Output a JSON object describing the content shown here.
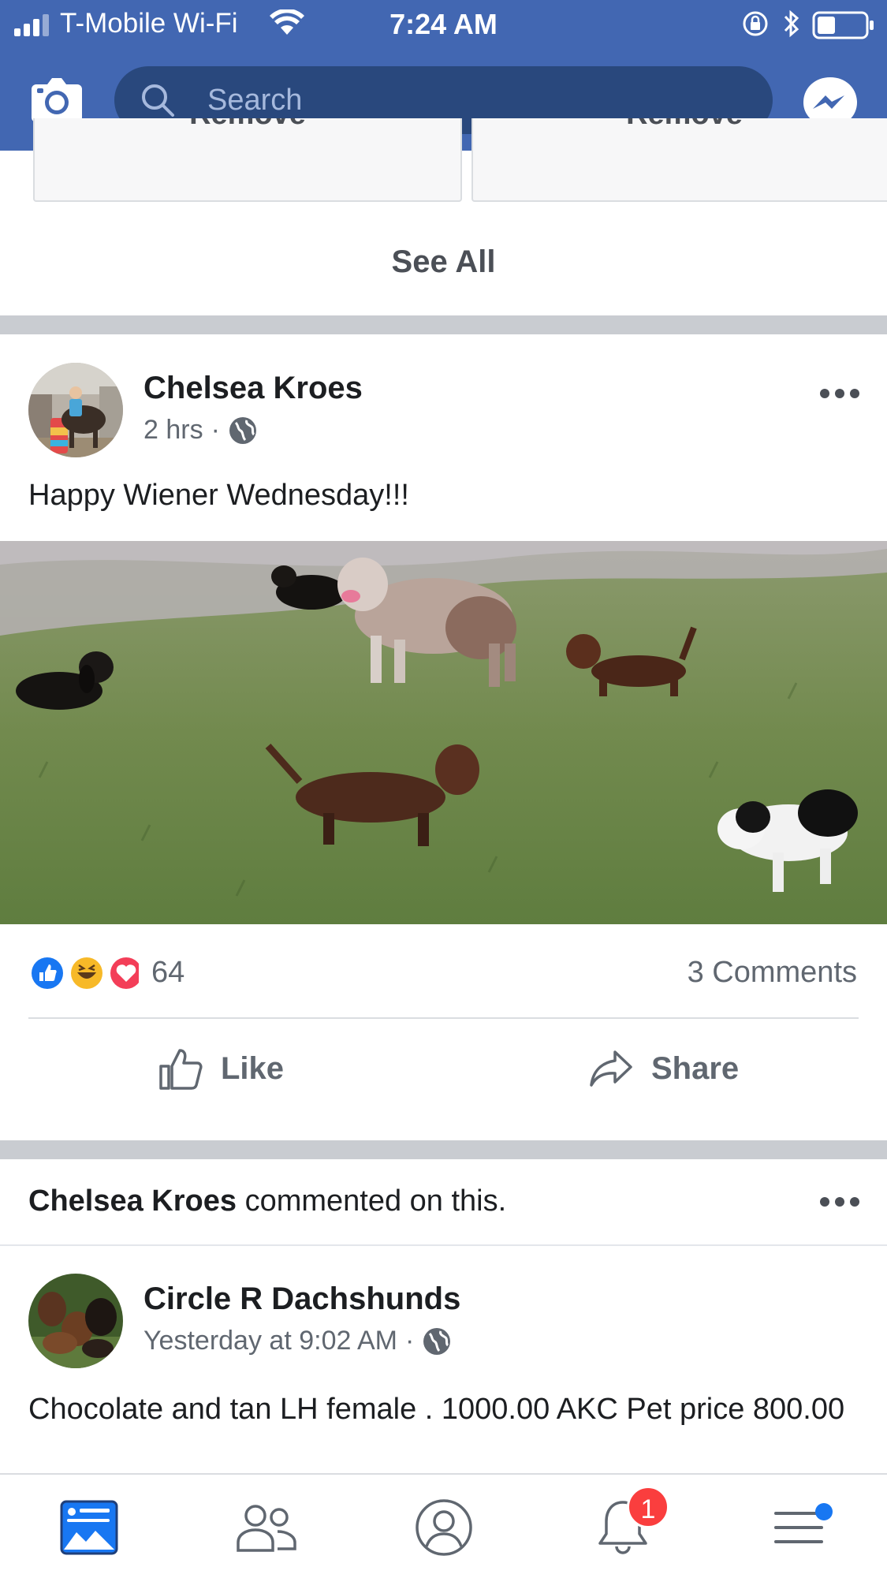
{
  "status_bar": {
    "carrier": "T-Mobile Wi-Fi",
    "time": "7:24 AM"
  },
  "header": {
    "search_placeholder": "Search",
    "brand_color": "#4267b2"
  },
  "suggestions": {
    "remove_label": "Remove",
    "see_all_label": "See All"
  },
  "post1": {
    "author": "Chelsea Kroes",
    "time": "2 hrs",
    "privacy_icon": "globe-icon",
    "text": "Happy Wiener Wednesday!!!",
    "reactions": {
      "types": [
        "like",
        "haha",
        "love"
      ],
      "count": "64"
    },
    "comments": "3 Comments",
    "actions": {
      "like": "Like",
      "share": "Share"
    }
  },
  "story2": {
    "actor": "Chelsea Kroes",
    "activity": " commented on this.",
    "author": "Circle R Dachshunds",
    "time": "Yesterday at 9:02 AM",
    "privacy_icon": "globe-icon",
    "text": "Chocolate and tan LH female . 1000.00 AKC Pet price 800.00"
  },
  "tabbar": {
    "tabs": [
      "news-feed",
      "friends",
      "profile",
      "notifications",
      "menu"
    ],
    "active": "news-feed",
    "notification_badge": "1"
  }
}
